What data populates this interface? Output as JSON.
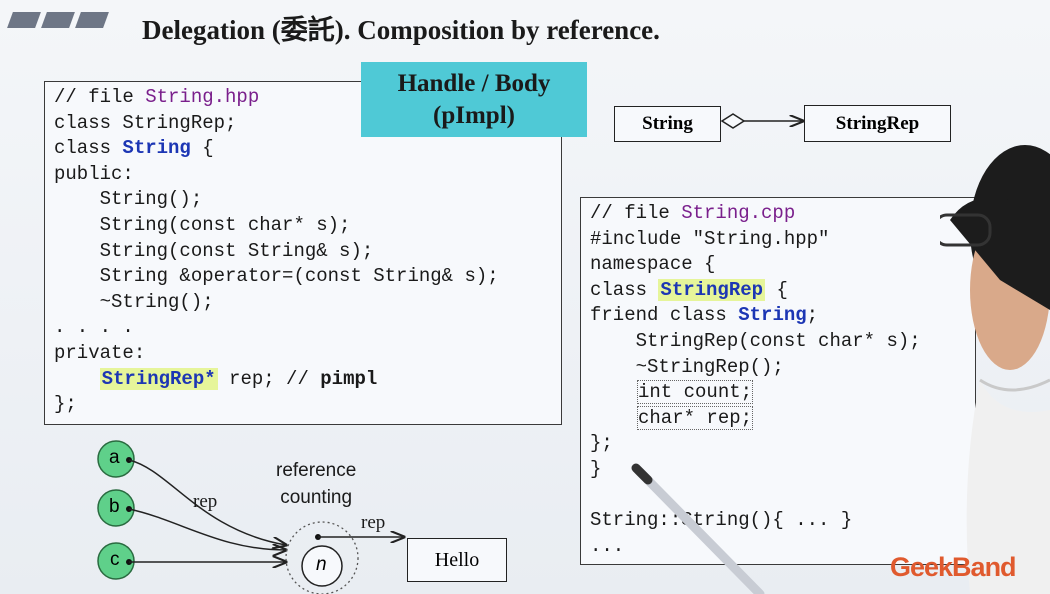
{
  "slide": {
    "title": "Delegation (委託). Composition by reference.",
    "handle_body": {
      "line1": "Handle / Body",
      "line2": "(pImpl)"
    },
    "uml": {
      "left": "String",
      "right": "StringRep"
    },
    "diagram": {
      "circles": [
        "a",
        "b",
        "c"
      ],
      "center": "n",
      "rep_label_1": "rep",
      "rep_label_2": "rep",
      "ref_line1": "reference",
      "ref_line2": "counting",
      "target": "Hello"
    },
    "watermark": "GeekBand"
  },
  "left_code": {
    "l1_comment": "// file ",
    "l1_file": "String.hpp",
    "l2": "class StringRep;",
    "l3_kw": "class ",
    "l3_name": "String",
    "l3_rest": " {",
    "l4": "public:",
    "l5": "    String();",
    "l6": "    String(const char* s);",
    "l7": "    String(const String& s);",
    "l8": "    String &operator=(const String& s);",
    "l9": "    ~String();",
    "l10": ". . . .",
    "l11": "private:",
    "l12_indent": "    ",
    "l12_hl": "StringRep*",
    "l12_mid": " rep; // ",
    "l12_bold": "pimpl",
    "l13": "};"
  },
  "right_code": {
    "l1_comment": "// file ",
    "l1_file": "String.cpp",
    "l2": "#include \"String.hpp\"",
    "l3": "namespace {",
    "l4_kw": "class ",
    "l4_hl": "StringRep",
    "l4_rest": " {",
    "l5_kw": "friend class ",
    "l5_name": "String",
    "l5_rest": ";",
    "l6": "    StringRep(const char* s);",
    "l7": "    ~StringRep();",
    "l8": "int count;",
    "l9": "char* rep;",
    "l10": "};",
    "l11": "}",
    "l12": "",
    "l13": "String::String(){ ... }",
    "l14": "..."
  }
}
